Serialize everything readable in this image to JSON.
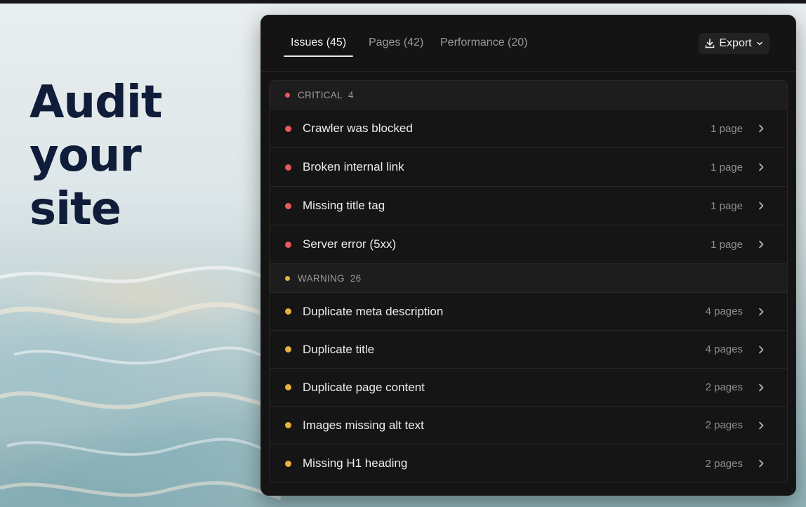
{
  "headline": [
    "Audit",
    "your",
    "site"
  ],
  "tabs": [
    {
      "label": "Issues (45)",
      "active": true
    },
    {
      "label": "Pages (42)",
      "active": false
    },
    {
      "label": "Performance (20)",
      "active": false
    }
  ],
  "export": {
    "label": "Export",
    "icon": "download-icon"
  },
  "colors": {
    "critical": "#e5595c",
    "warning": "#e6b23f",
    "accent_text": "#0f1d3a"
  },
  "groups": [
    {
      "name": "CRITICAL",
      "count": "4",
      "items": [
        {
          "title": "Crawler was blocked",
          "pages": "1 page"
        },
        {
          "title": "Broken internal link",
          "pages": "1 page"
        },
        {
          "title": "Missing title tag",
          "pages": "1 page"
        },
        {
          "title": "Server error (5xx)",
          "pages": "1 page"
        }
      ]
    },
    {
      "name": "WARNING",
      "count": "26",
      "items": [
        {
          "title": "Duplicate meta description",
          "pages": "4 pages"
        },
        {
          "title": "Duplicate title",
          "pages": "4 pages"
        },
        {
          "title": "Duplicate page content",
          "pages": "2 pages"
        },
        {
          "title": "Images missing alt text",
          "pages": "2 pages"
        },
        {
          "title": "Missing H1 heading",
          "pages": "2 pages"
        }
      ]
    }
  ]
}
